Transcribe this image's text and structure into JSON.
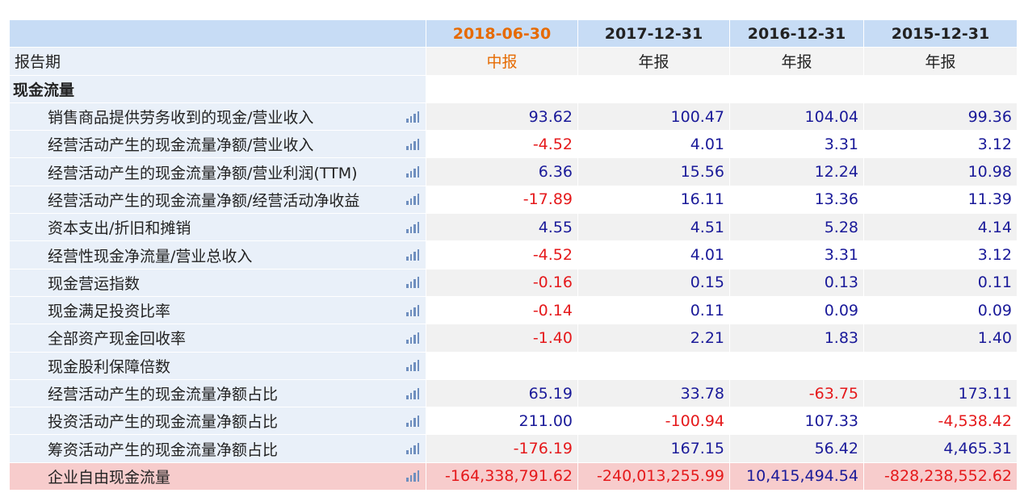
{
  "header": {
    "label": "",
    "periods": [
      "2018-06-30",
      "2017-12-31",
      "2016-12-31",
      "2015-12-31"
    ]
  },
  "report_type": {
    "label": "报告期",
    "values": [
      "中报",
      "年报",
      "年报",
      "年报"
    ]
  },
  "section": {
    "title": "现金流量"
  },
  "rows": [
    {
      "label": "销售商品提供劳务收到的现金/营业收入",
      "values": [
        "93.62",
        "100.47",
        "104.04",
        "99.36"
      ],
      "signs": [
        "pos",
        "pos",
        "pos",
        "pos"
      ]
    },
    {
      "label": "经营活动产生的现金流量净额/营业收入",
      "values": [
        "-4.52",
        "4.01",
        "3.31",
        "3.12"
      ],
      "signs": [
        "neg",
        "pos",
        "pos",
        "pos"
      ]
    },
    {
      "label": "经营活动产生的现金流量净额/营业利润(TTM)",
      "values": [
        "6.36",
        "15.56",
        "12.24",
        "10.98"
      ],
      "signs": [
        "pos",
        "pos",
        "pos",
        "pos"
      ]
    },
    {
      "label": "经营活动产生的现金流量净额/经营活动净收益",
      "values": [
        "-17.89",
        "16.11",
        "13.36",
        "11.39"
      ],
      "signs": [
        "neg",
        "pos",
        "pos",
        "pos"
      ]
    },
    {
      "label": "资本支出/折旧和摊销",
      "values": [
        "4.55",
        "4.51",
        "5.28",
        "4.14"
      ],
      "signs": [
        "pos",
        "pos",
        "pos",
        "pos"
      ]
    },
    {
      "label": "经营性现金净流量/营业总收入",
      "values": [
        "-4.52",
        "4.01",
        "3.31",
        "3.12"
      ],
      "signs": [
        "neg",
        "pos",
        "pos",
        "pos"
      ]
    },
    {
      "label": "现金营运指数",
      "values": [
        "-0.16",
        "0.15",
        "0.13",
        "0.11"
      ],
      "signs": [
        "neg",
        "pos",
        "pos",
        "pos"
      ]
    },
    {
      "label": "现金满足投资比率",
      "values": [
        "-0.14",
        "0.11",
        "0.09",
        "0.09"
      ],
      "signs": [
        "neg",
        "pos",
        "pos",
        "pos"
      ]
    },
    {
      "label": "全部资产现金回收率",
      "values": [
        "-1.40",
        "2.21",
        "1.83",
        "1.40"
      ],
      "signs": [
        "neg",
        "pos",
        "pos",
        "pos"
      ]
    },
    {
      "label": "现金股利保障倍数",
      "values": [
        "",
        "",
        "",
        ""
      ],
      "signs": [
        "pos",
        "pos",
        "pos",
        "pos"
      ]
    },
    {
      "label": "经营活动产生的现金流量净额占比",
      "values": [
        "65.19",
        "33.78",
        "-63.75",
        "173.11"
      ],
      "signs": [
        "pos",
        "pos",
        "neg",
        "pos"
      ]
    },
    {
      "label": "投资活动产生的现金流量净额占比",
      "values": [
        "211.00",
        "-100.94",
        "107.33",
        "-4,538.42"
      ],
      "signs": [
        "pos",
        "neg",
        "pos",
        "neg"
      ]
    },
    {
      "label": "筹资活动产生的现金流量净额占比",
      "values": [
        "-176.19",
        "167.15",
        "56.42",
        "4,465.31"
      ],
      "signs": [
        "neg",
        "pos",
        "pos",
        "pos"
      ]
    },
    {
      "label": "企业自由现金流量",
      "values": [
        "-164,338,791.62",
        "-240,013,255.99",
        "10,415,494.54",
        "-828,238,552.62"
      ],
      "signs": [
        "neg",
        "neg",
        "pos",
        "neg"
      ]
    }
  ],
  "icons": {
    "row_chart": "bar-chart-icon"
  },
  "colors": {
    "positive": "#1a1a99",
    "negative": "#e5191b",
    "highlight_period": "#e66a00",
    "header_bg": "#c7dcf5",
    "highlight_row_bg": "#f7cccc"
  }
}
